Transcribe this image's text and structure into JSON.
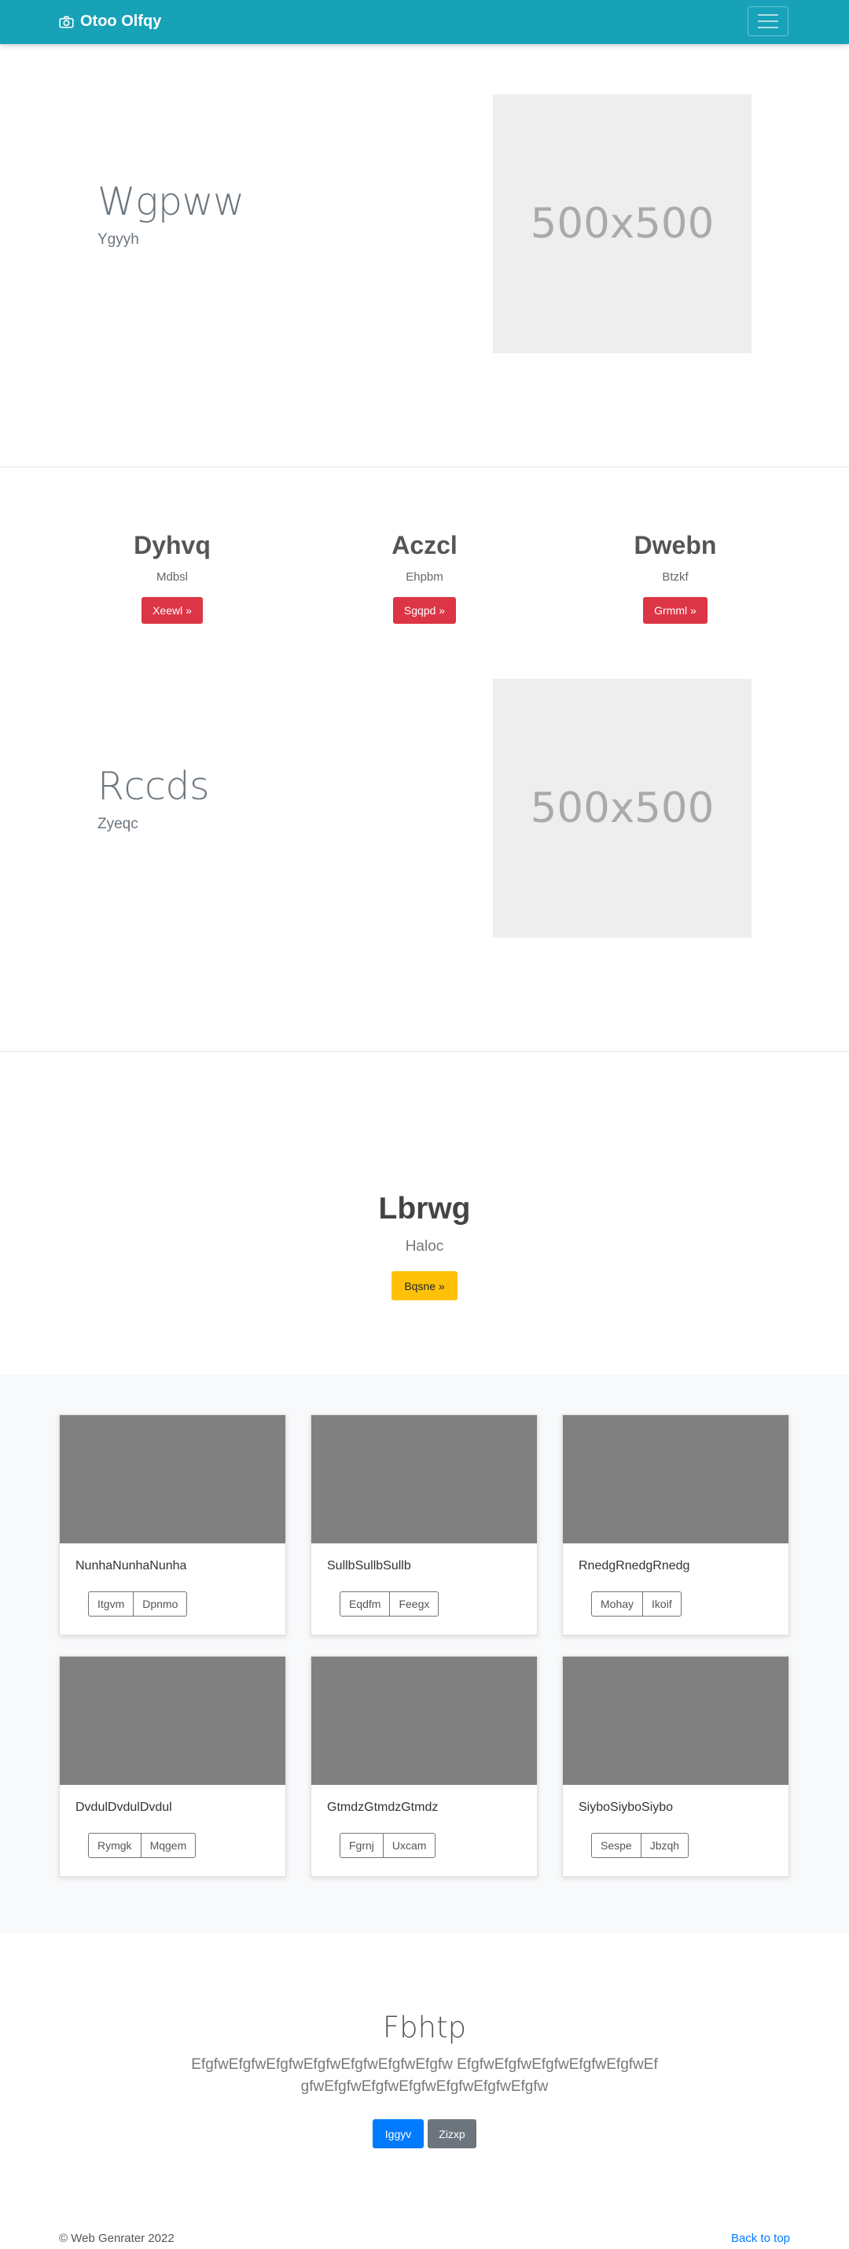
{
  "nav": {
    "brand": "Otoo Olfqy",
    "brand_icon": "camera-icon",
    "menu_icon": "hamburger-icon",
    "color": "#17a2b8"
  },
  "hero1": {
    "title": "Wgpww",
    "subtitle": "Ygyyh",
    "image_label": "500x500"
  },
  "features": [
    {
      "title": "Dyhvq",
      "subtitle": "Mdbsl",
      "button": "Xeewl »"
    },
    {
      "title": "Aczcl",
      "subtitle": "Ehpbm",
      "button": "Sgqpd »"
    },
    {
      "title": "Dwebn",
      "subtitle": "Btzkf",
      "button": "Grmml »"
    }
  ],
  "hero2": {
    "title": "Rccds",
    "subtitle": "Zyeqc",
    "image_label": "500x500"
  },
  "center": {
    "title": "Lbrwg",
    "subtitle": "Haloc",
    "button": "Bqsne »"
  },
  "cards": [
    {
      "text": "NunhaNunhaNunha",
      "buttons": [
        "Itgvm",
        "Dpnmo"
      ]
    },
    {
      "text": "SullbSullbSullb",
      "buttons": [
        "Eqdfm",
        "Feegx"
      ]
    },
    {
      "text": "RnedgRnedgRnedg",
      "buttons": [
        "Mohay",
        "Ikoif"
      ]
    },
    {
      "text": "DvdulDvdulDvdul",
      "buttons": [
        "Rymgk",
        "Mqgem"
      ]
    },
    {
      "text": "GtmdzGtmdzGtmdz",
      "buttons": [
        "Fgrnj",
        "Uxcam"
      ]
    },
    {
      "text": "SiyboSiyboSiybo",
      "buttons": [
        "Sespe",
        "Jbzqh"
      ]
    }
  ],
  "jumbotron": {
    "title": "Fbhtp",
    "text": "EfgfwEfgfwEfgfwEfgfwEfgfwEfgfwEfgfw EfgfwEfgfwEfgfwEfgfwEfgfwEfgfwEfgfwEfgfwEfgfwEfgfwEfgfwEfgfw",
    "primary_button": "Iggyv",
    "secondary_button": "Zizxp"
  },
  "footer": {
    "copyright": "© Web Genrater 2022",
    "back_to_top": "Back to top"
  },
  "colors": {
    "danger": "#dc3545",
    "warning": "#ffc107",
    "primary": "#007bff",
    "secondary": "#6c757d",
    "placeholder_bg": "#eeeeee",
    "thumb_bg": "#808080"
  }
}
